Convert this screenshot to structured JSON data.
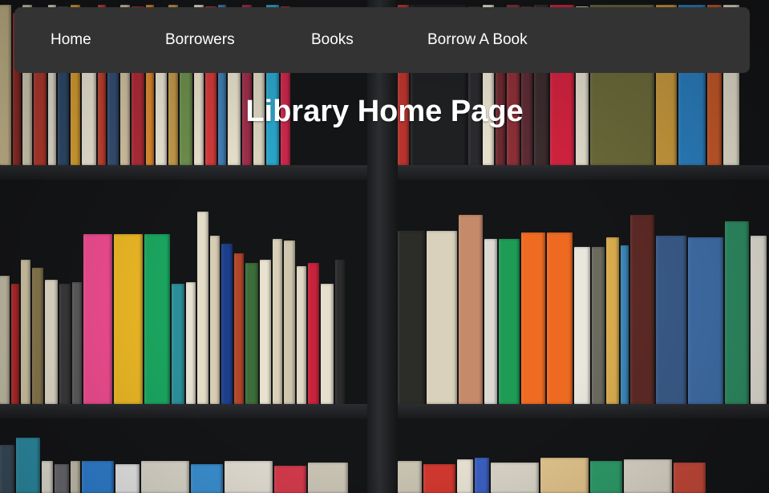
{
  "nav": {
    "items": [
      {
        "label": "Home"
      },
      {
        "label": "Borrowers"
      },
      {
        "label": "Books"
      },
      {
        "label": "Borrow A Book"
      }
    ]
  },
  "main": {
    "title": "Library Home Page"
  },
  "background": {
    "image": "bookshelf-photo",
    "colors": {
      "navbar": "#333333",
      "nav_text": "#ffffff",
      "title_text": "#ffffff"
    }
  }
}
